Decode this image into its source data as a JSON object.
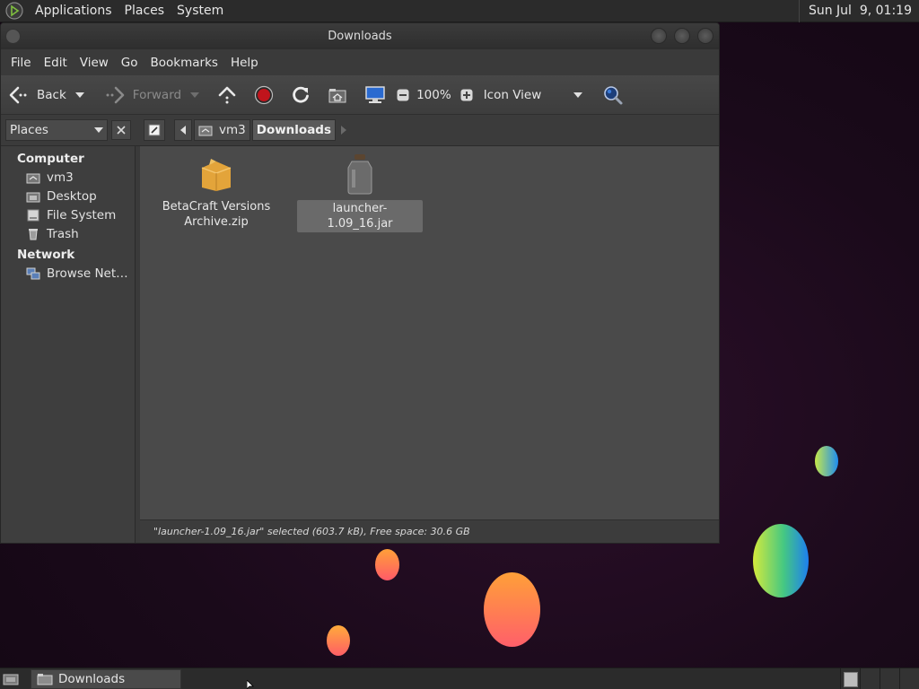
{
  "top_panel": {
    "menus": [
      "Applications",
      "Places",
      "System"
    ],
    "clock": "Sun Jul  9, 01:19"
  },
  "window": {
    "title": "Downloads",
    "menubar": [
      "File",
      "Edit",
      "View",
      "Go",
      "Bookmarks",
      "Help"
    ],
    "toolbar": {
      "back": "Back",
      "forward": "Forward",
      "zoom": "100%",
      "view_mode": "Icon View"
    },
    "location": {
      "sidebar_select": "Places",
      "path": [
        "vm3",
        "Downloads"
      ]
    },
    "sidebar": {
      "computer_heading": "Computer",
      "computer_items": [
        "vm3",
        "Desktop",
        "File System",
        "Trash"
      ],
      "network_heading": "Network",
      "network_items": [
        "Browse Net…"
      ]
    },
    "files": [
      {
        "name_line1": "BetaCraft Versions",
        "name_line2": "Archive.zip",
        "icon": "package-icon",
        "selected": false
      },
      {
        "name_line1": "launcher-1.09_16.jar",
        "name_line2": "",
        "icon": "jar-icon",
        "selected": true
      }
    ],
    "status": "\"launcher-1.09_16.jar\" selected (603.7 kB), Free space: 30.6 GB"
  },
  "taskbar": {
    "task": "Downloads"
  },
  "colors": {
    "desktop": "#1a0a1a",
    "window_bg": "#4a4a4a",
    "record_red": "#c0141c",
    "search_blue": "#3b7bd8"
  }
}
